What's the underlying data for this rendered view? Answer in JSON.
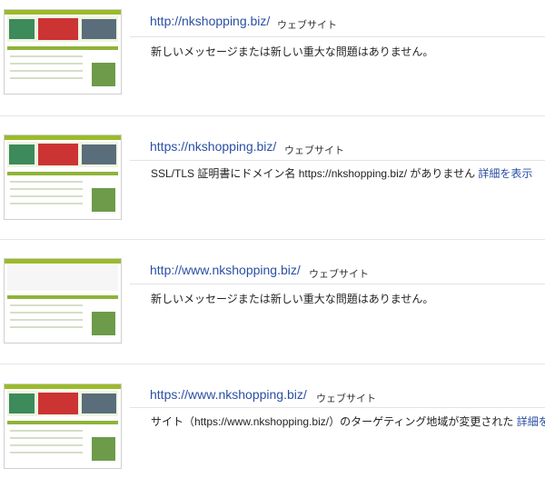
{
  "sites": [
    {
      "url": "http://nkshopping.biz/",
      "type": "ウェブサイト",
      "message": "新しいメッセージまたは新しい重大な問題はありません。",
      "link": ""
    },
    {
      "url": "https://nkshopping.biz/",
      "type": "ウェブサイト",
      "message": "SSL/TLS 証明書にドメイン名 https://nkshopping.biz/ がありません",
      "link": "詳細を表示"
    },
    {
      "url": "http://www.nkshopping.biz/",
      "type": "ウェブサイト",
      "message": "新しいメッセージまたは新しい重大な問題はありません。",
      "link": ""
    },
    {
      "url": "https://www.nkshopping.biz/",
      "type": "ウェブサイト",
      "message": "サイト（https://www.nkshopping.biz/）のターゲティング地域が変更された",
      "link": "詳細を表示"
    }
  ]
}
